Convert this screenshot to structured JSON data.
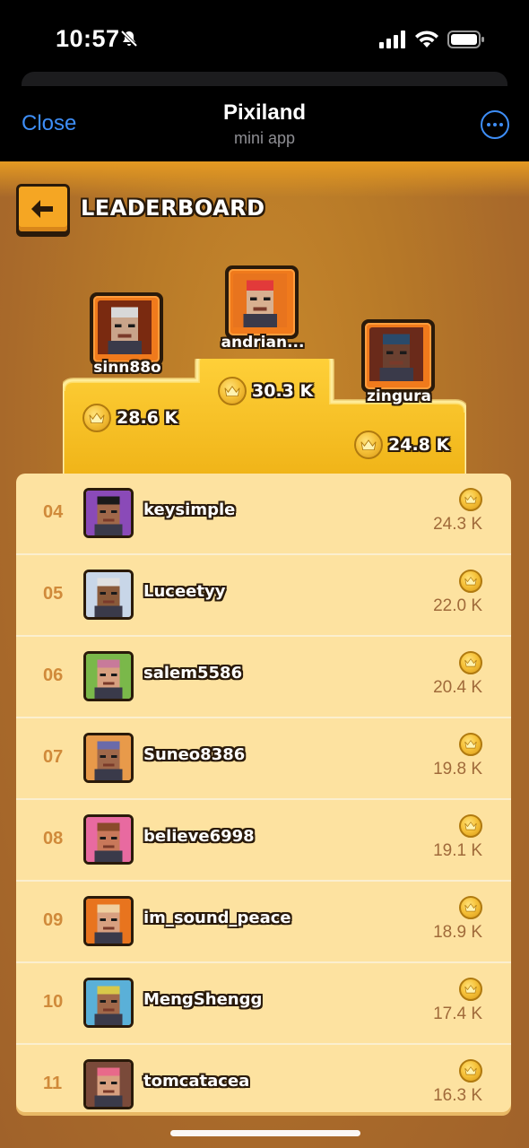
{
  "status_bar": {
    "time": "10:57"
  },
  "app_header": {
    "close_label": "Close",
    "title": "Pixiland",
    "subtitle": "mini app"
  },
  "leaderboard": {
    "title": "LEADERBOARD"
  },
  "podium": [
    {
      "place": 2,
      "name": "sinn88o",
      "score": "28.6 K",
      "avatar": "old-man-avatar",
      "bg": "#7a2a10",
      "skin": "#c9a48a",
      "hair": "#d8d8d8"
    },
    {
      "place": 1,
      "name": "andrian...",
      "score": "30.3 K",
      "avatar": "red-hat-avatar",
      "bg": "#e8741e",
      "skin": "#d8b090",
      "hair": "#e23a3a"
    },
    {
      "place": 3,
      "name": "zingura",
      "score": "24.8 K",
      "avatar": "punk-avatar",
      "bg": "#6a2a1a",
      "skin": "#6a4030",
      "hair": "#2a4a6a"
    }
  ],
  "rows": [
    {
      "rank": "04",
      "name": "keysimple",
      "score": "24.3 K",
      "bg": "#8a4ab8",
      "skin": "#a0684a",
      "hair": "#1a1a1a"
    },
    {
      "rank": "05",
      "name": "Luceetyy",
      "score": "22.0 K",
      "bg": "#c8d6e8",
      "skin": "#8a5a3a",
      "hair": "#e0e0e0"
    },
    {
      "rank": "06",
      "name": "salem5586",
      "score": "20.4 K",
      "bg": "#7ab84a",
      "skin": "#d8a080",
      "hair": "#c87a9a"
    },
    {
      "rank": "07",
      "name": "Suneo8386",
      "score": "19.8 K",
      "bg": "#e89a4a",
      "skin": "#a0684a",
      "hair": "#6a6aaa"
    },
    {
      "rank": "08",
      "name": "believe6998",
      "score": "19.1 K",
      "bg": "#e86aa0",
      "skin": "#c8785a",
      "hair": "#8a4a2a"
    },
    {
      "rank": "09",
      "name": "im_sound_peace",
      "score": "18.9 K",
      "bg": "#e8741e",
      "skin": "#d8a080",
      "hair": "#f0d0a0"
    },
    {
      "rank": "10",
      "name": "MengShengg",
      "score": "17.4 K",
      "bg": "#5ab0d8",
      "skin": "#a0684a",
      "hair": "#d8c84a"
    },
    {
      "rank": "11",
      "name": "tomcatacea",
      "score": "16.3 K",
      "bg": "#7a4a3a",
      "skin": "#d8a080",
      "hair": "#e86a8a"
    }
  ],
  "colors": {
    "accent_blue": "#3e8ef7",
    "gold": "#f5a623",
    "panel": "#fde2a0",
    "rank_text": "#d08a3a",
    "score_text": "#a06a3a"
  }
}
